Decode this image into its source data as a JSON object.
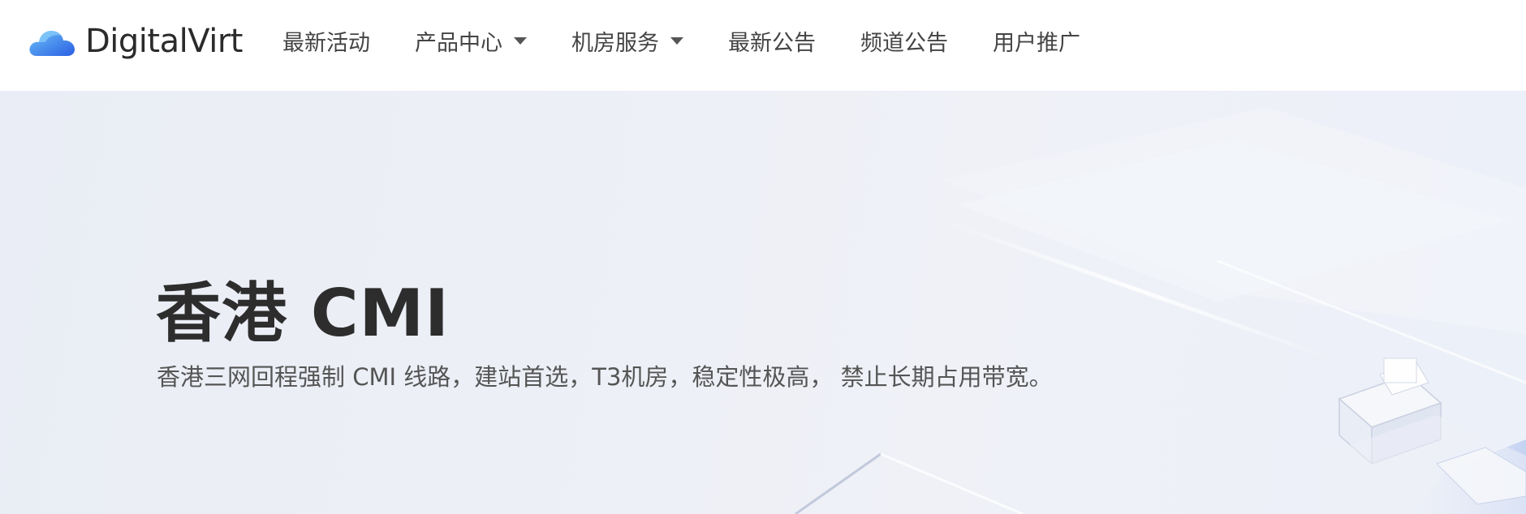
{
  "brand": {
    "name": "DigitalVirt",
    "logo_icon": "cloud-icon",
    "colors": {
      "cloud_light": "#5aa9f5",
      "cloud_dark": "#2d6ee8"
    }
  },
  "nav": {
    "items": [
      {
        "label": "最新活动",
        "has_dropdown": false
      },
      {
        "label": "产品中心",
        "has_dropdown": true
      },
      {
        "label": "机房服务",
        "has_dropdown": true
      },
      {
        "label": "最新公告",
        "has_dropdown": false
      },
      {
        "label": "频道公告",
        "has_dropdown": false
      },
      {
        "label": "用户推广",
        "has_dropdown": false
      }
    ]
  },
  "hero": {
    "title": "香港 CMI",
    "subtitle": "香港三网回程强制 CMI 线路，建站首选，T3机房，稳定性极高， 禁止长期占用带宽。",
    "background_color": "#edf0f6"
  }
}
